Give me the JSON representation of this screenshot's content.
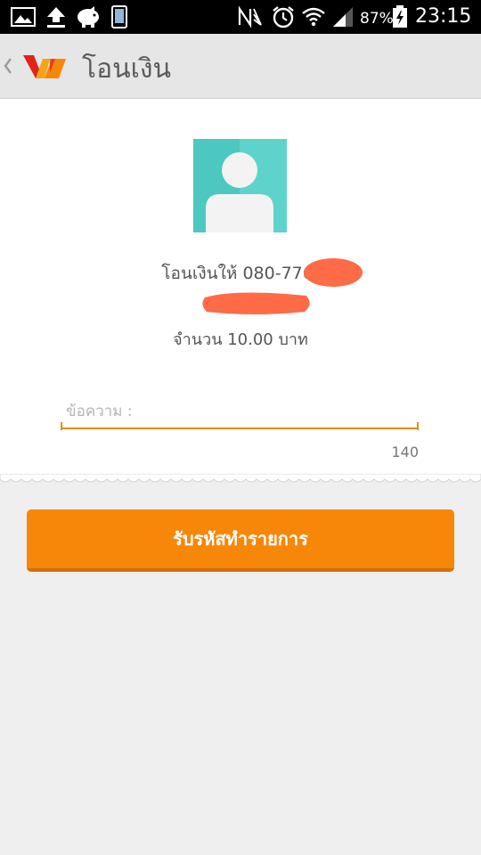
{
  "status_bar": {
    "battery_percent": "87%",
    "time": "23:15",
    "icons": [
      "image-icon",
      "upload-icon",
      "piggy-bank-icon",
      "phone-icon",
      "nfc-icon",
      "alarm-icon",
      "wifi-icon",
      "signal-icon",
      "battery-charging-icon"
    ]
  },
  "app_bar": {
    "title": "โอนเงิน",
    "back_icon": "chevron-left-icon",
    "logo_icon": "wallet-logo-icon"
  },
  "transfer": {
    "recipient_label": "โอนเงินให้ 080-776-",
    "amount_text": "จำนวน 10.00 บาท"
  },
  "message": {
    "placeholder": "ข้อความ :",
    "value": "",
    "counter": "140"
  },
  "actions": {
    "submit_label": "รับรหัสทำรายการ"
  },
  "colors": {
    "accent": "#f78709",
    "field_underline": "#e58a12",
    "redaction": "#ff6b47",
    "avatar_bg": "#4cc8c0"
  }
}
